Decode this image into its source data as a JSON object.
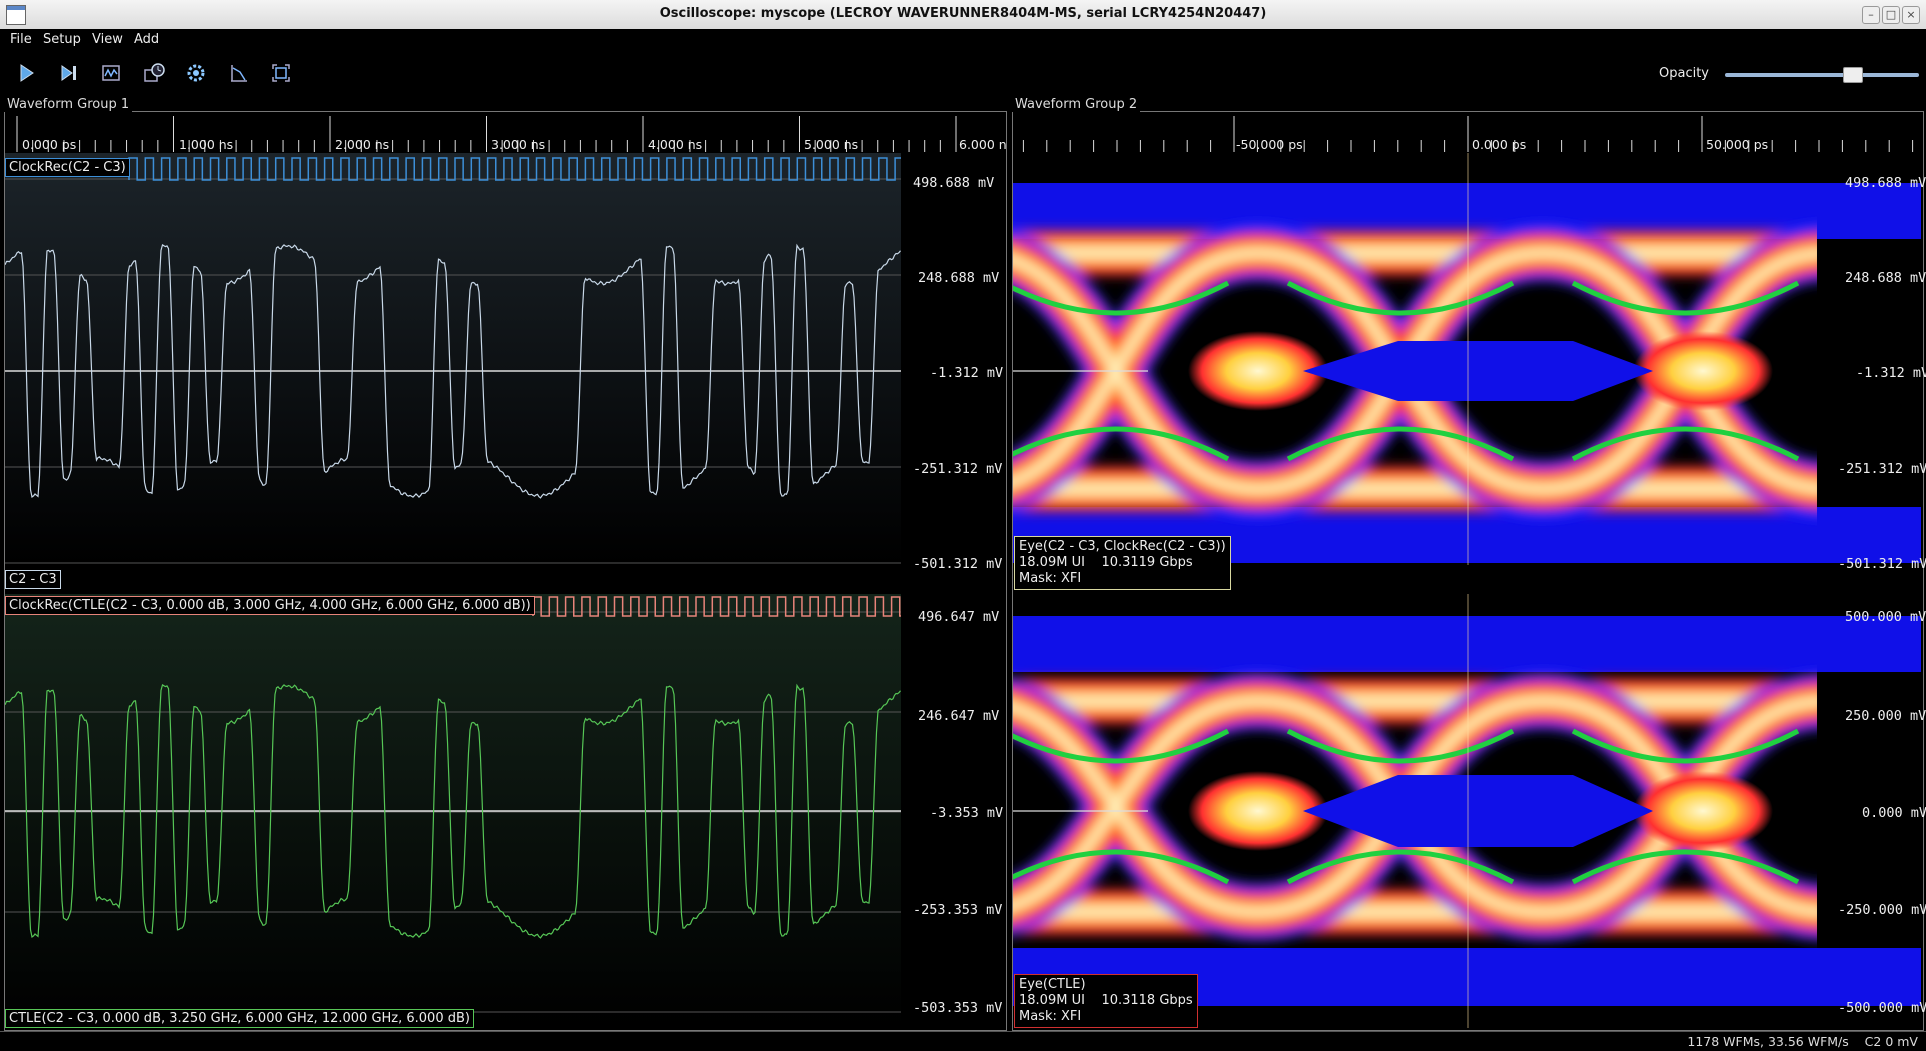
{
  "window": {
    "title": "Oscilloscope: myscope (LECROY WAVERUNNER8404M-MS, serial LCRY4254N20447)"
  },
  "menu": [
    "File",
    "Setup",
    "View",
    "Add"
  ],
  "toolbar": {
    "buttons": [
      "start-trigger",
      "single-trigger",
      "history",
      "zoom-fit",
      "configure",
      "quick-measure",
      "fullscreen"
    ],
    "opacity_label": "Opacity",
    "opacity_value": 0.6
  },
  "group1": {
    "title": "Waveform Group 1",
    "time_ticks": [
      "0.000 ps",
      "1.000 ns",
      "2.000 ns",
      "3.000 ns",
      "4.000 ns",
      "5.000 ns",
      "6.000 n"
    ],
    "top": {
      "clock_label": "ClockRec(C2 - C3)",
      "volt_labels": [
        "498.688 mV",
        "248.688 mV",
        "-1.312 mV",
        "-251.312 mV",
        "-501.312 mV"
      ],
      "trace_label": "C2 - C3",
      "trace_color": "#c8d8e8",
      "clock_color": "#3d8fd8"
    },
    "bottom": {
      "clock_label": "ClockRec(CTLE(C2 - C3, 0.000 dB, 3.000 GHz, 4.000 GHz, 6.000 GHz, 6.000 dB))",
      "volt_labels": [
        "496.647 mV",
        "246.647 mV",
        "-3.353 mV",
        "-253.353 mV",
        "-503.353 mV"
      ],
      "trace_label": "CTLE(C2 - C3, 0.000 dB, 3.250 GHz, 6.000 GHz, 12.000 GHz, 6.000 dB)",
      "trace_color": "#56c656",
      "clock_color": "#e8847a"
    }
  },
  "group2": {
    "title": "Waveform Group 2",
    "time_ticks": [
      "-50.000 ps",
      "0.000 ps",
      "50.000 ps"
    ],
    "top": {
      "volt_labels": [
        "498.688 mV",
        "248.688 mV",
        "-1.312 mV",
        "-251.312 mV",
        "-501.312 mV"
      ],
      "eye_line1": "Eye(C2 - C3, ClockRec(C2 - C3))",
      "eye_line2": "18.09M UI    10.3119 Gbps",
      "eye_line3": "Mask: XFI",
      "border_color": "#d8d8a0"
    },
    "bottom": {
      "volt_labels": [
        "500.000 mV",
        "250.000 mV",
        "0.000 mV",
        "-250.000 mV",
        "-500.000 mV"
      ],
      "eye_line1": "Eye(CTLE)",
      "eye_line2": "18.09M UI    10.3118 Gbps",
      "eye_line3": "Mask: XFI",
      "border_color": "#d03030"
    }
  },
  "status": {
    "text": "1178 WFMs, 33.56 WFM/s    C2 0 mV"
  }
}
